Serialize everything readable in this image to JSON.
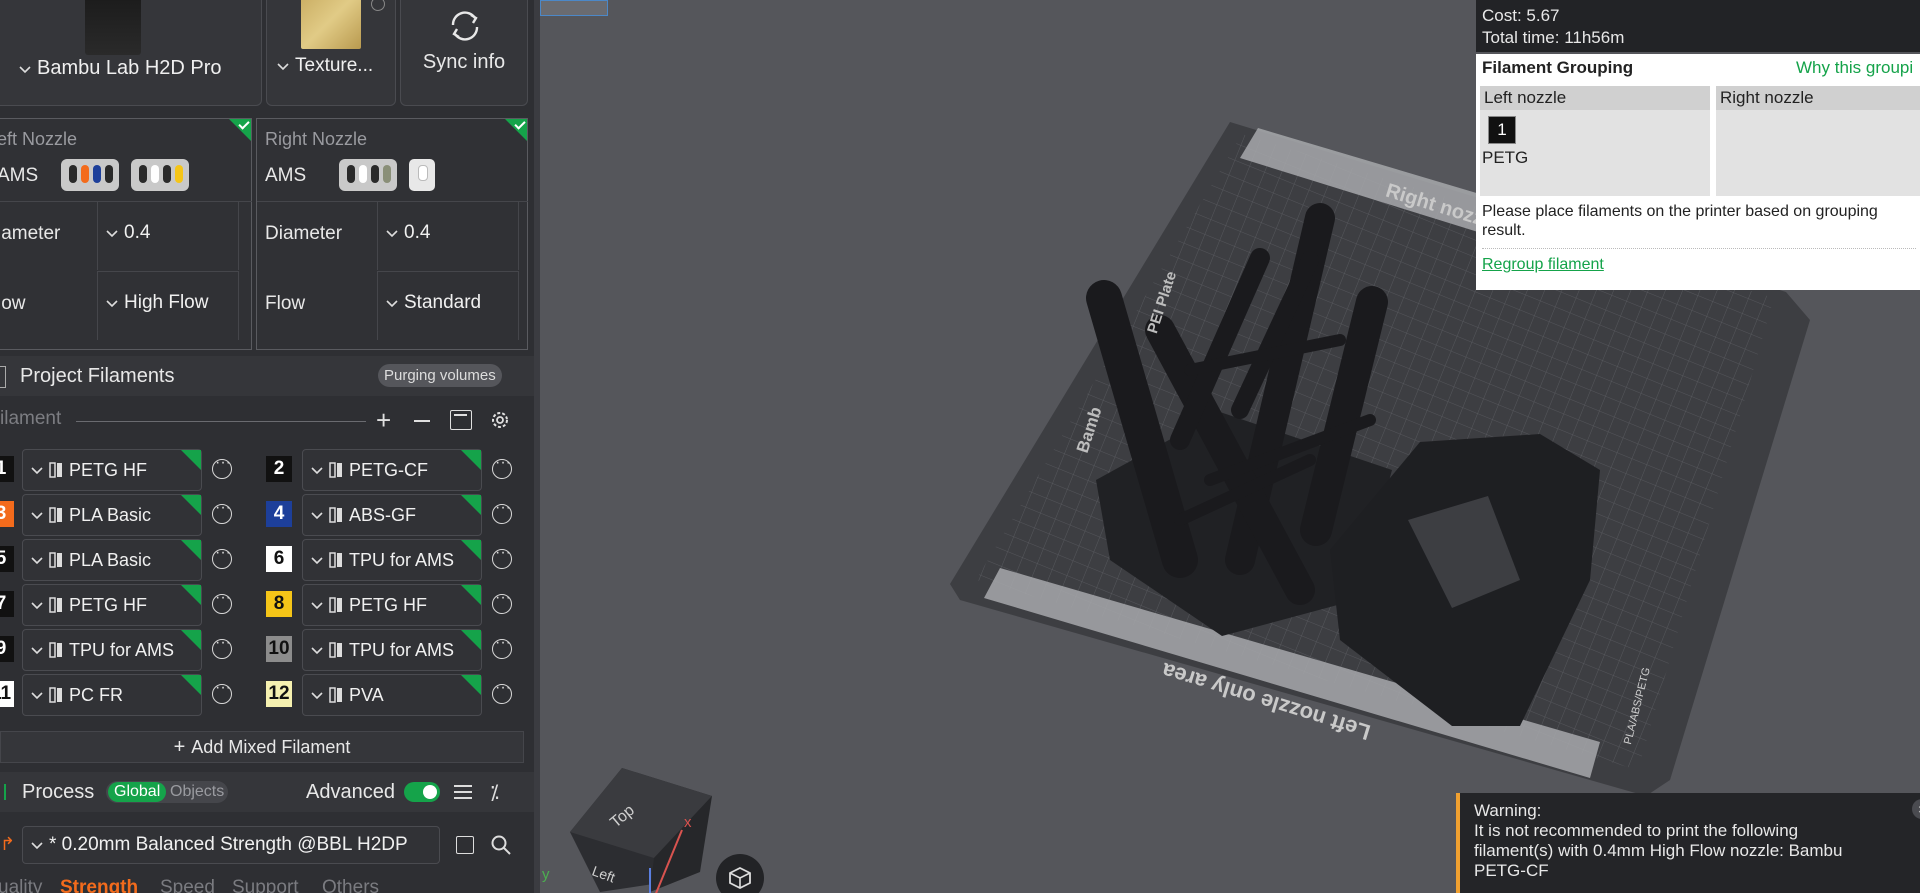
{
  "printer": {
    "name": "Bambu Lab H2D Pro",
    "plate": "Texture...",
    "sync_label": "Sync info"
  },
  "left_nozzle": {
    "title": "eft Nozzle",
    "ams_label": "AMS",
    "diameter_label": "iameter",
    "diameter_value": "0.4",
    "flow_label": "low",
    "flow_value": "High Flow"
  },
  "right_nozzle": {
    "title": "Right Nozzle",
    "ams_label": "AMS",
    "diameter_label": "Diameter",
    "diameter_value": "0.4",
    "flow_label": "Flow",
    "flow_value": "Standard"
  },
  "project": {
    "title": "Project Filaments",
    "purging_label": "Purging volumes",
    "filament_label": "ilament",
    "add_mixed_label": "Add Mixed Filament"
  },
  "filaments": [
    {
      "num": "1",
      "name": "PETG HF",
      "color": "#111111",
      "text": "#ffffff"
    },
    {
      "num": "2",
      "name": "PETG-CF",
      "color": "#111111",
      "text": "#ffffff"
    },
    {
      "num": "3",
      "name": "PLA Basic",
      "color": "#f36b1c",
      "text": "#ffffff"
    },
    {
      "num": "4",
      "name": "ABS-GF",
      "color": "#1d3f9a",
      "text": "#ffffff"
    },
    {
      "num": "5",
      "name": "PLA Basic",
      "color": "#111111",
      "text": "#ffffff"
    },
    {
      "num": "6",
      "name": "TPU for AMS",
      "color": "#ffffff",
      "text": "#111111"
    },
    {
      "num": "7",
      "name": "PETG HF",
      "color": "#111111",
      "text": "#ffffff"
    },
    {
      "num": "8",
      "name": "PETG HF",
      "color": "#f5c518",
      "text": "#111111"
    },
    {
      "num": "9",
      "name": "TPU for AMS",
      "color": "#111111",
      "text": "#ffffff"
    },
    {
      "num": "10",
      "name": "TPU for AMS",
      "color": "#8c8c8c",
      "text": "#111111"
    },
    {
      "num": "11",
      "name": "PC FR",
      "color": "#ffffff",
      "text": "#111111"
    },
    {
      "num": "12",
      "name": "PVA",
      "color": "#f5f0b0",
      "text": "#111111"
    }
  ],
  "process": {
    "title": "Process",
    "global_label": "Global",
    "objects_label": "Objects",
    "advanced_label": "Advanced",
    "preset": "* 0.20mm Balanced Strength @BBL H2DP",
    "tabs": [
      "uality",
      "Strength",
      "Speed",
      "Support",
      "Others"
    ]
  },
  "grouping": {
    "cost": "Cost: 5.67",
    "total_time": "Total time: 11h56m",
    "title": "Filament Grouping",
    "why_link": "Why this groupi",
    "left_header": "Left nozzle",
    "right_header": "Right nozzle",
    "left_slot_num": "1",
    "left_slot_name": "PETG",
    "instruction": "Please place filaments on the printer based on grouping result.",
    "regroup_link": "Regroup filament"
  },
  "plate_text": {
    "right_only": "Right nozz",
    "left_only": "Left nozzle only area",
    "brand": "Bamb",
    "plate_name": "PEI Plate",
    "side_label": "PLA/ABS/PETG"
  },
  "view_cube": {
    "top": "Top",
    "left": "Left",
    "x": "x",
    "y": "y"
  },
  "warning": {
    "title": "Warning:",
    "body": "It is not recommended to print the following filament(s) with 0.4mm High Flow nozzle: Bambu PETG-CF"
  },
  "colors": {
    "accent_green": "#15a34a",
    "warning_orange": "#f0a030",
    "sidebar_bg": "#2e2f33"
  }
}
